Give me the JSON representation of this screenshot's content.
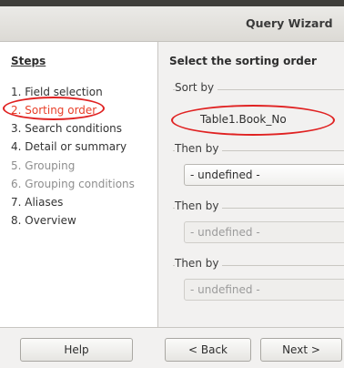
{
  "window": {
    "title": "Query Wizard"
  },
  "steps": {
    "heading": "Steps",
    "items": [
      {
        "label": "1. Field selection",
        "state": "normal"
      },
      {
        "label": "2. Sorting order",
        "state": "active"
      },
      {
        "label": "3. Search conditions",
        "state": "normal"
      },
      {
        "label": "4. Detail or summary",
        "state": "normal"
      },
      {
        "label": "5. Grouping",
        "state": "disabled"
      },
      {
        "label": "6. Grouping conditions",
        "state": "disabled"
      },
      {
        "label": "7. Aliases",
        "state": "normal"
      },
      {
        "label": "8. Overview",
        "state": "normal"
      }
    ]
  },
  "main": {
    "heading": "Select the sorting order",
    "groups": [
      {
        "label": "Sort by",
        "value": "Table1.Book_No",
        "enabled": true
      },
      {
        "label": "Then by",
        "value": "- undefined -",
        "enabled": true
      },
      {
        "label": "Then by",
        "value": "- undefined -",
        "enabled": false
      },
      {
        "label": "Then by",
        "value": "- undefined -",
        "enabled": false
      }
    ]
  },
  "buttons": {
    "help": "Help",
    "back": "< Back",
    "next": "Next >"
  },
  "colors": {
    "highlight_oval": "#e02222",
    "active_step_text": "#e8402a"
  }
}
